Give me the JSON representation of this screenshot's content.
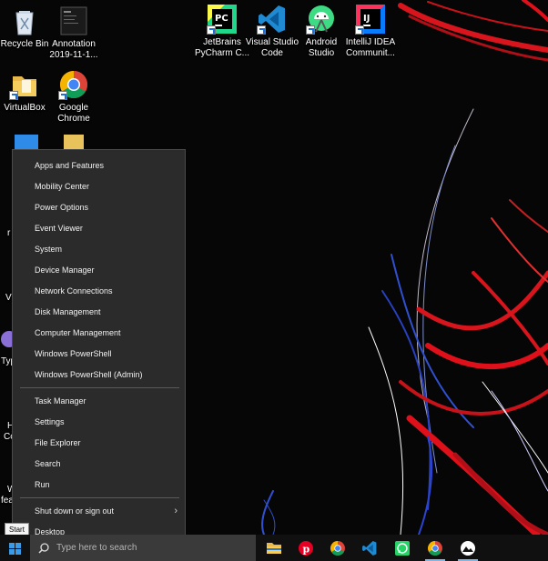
{
  "desktop_icons": [
    {
      "label": "Recycle Bin",
      "icon": "recycle-bin-icon"
    },
    {
      "label": "Annotation 2019-11-1...",
      "icon": "file-thumbnail-icon"
    },
    {
      "label": "VirtualBox",
      "icon": "folder-icon"
    },
    {
      "label": "Google Chrome",
      "icon": "chrome-icon"
    },
    {
      "label": "JetBrains PyCharm C...",
      "icon": "pycharm-icon"
    },
    {
      "label": "Visual Studio Code",
      "icon": "vscode-icon"
    },
    {
      "label": "Android Studio",
      "icon": "android-studio-icon"
    },
    {
      "label": "IntelliJ IDEA Communit...",
      "icon": "intellij-icon"
    }
  ],
  "partial_labels": [
    "r",
    "Vi",
    "Typ",
    "H",
    "Co",
    "W",
    "fea"
  ],
  "menu": {
    "group1": [
      "Apps and Features",
      "Mobility Center",
      "Power Options",
      "Event Viewer",
      "System",
      "Device Manager",
      "Network Connections",
      "Disk Management",
      "Computer Management",
      "Windows PowerShell",
      "Windows PowerShell (Admin)"
    ],
    "group2": [
      "Task Manager",
      "Settings",
      "File Explorer",
      "Search",
      "Run"
    ],
    "shutdown": "Shut down or sign out",
    "desktop": "Desktop"
  },
  "tooltip": "Start",
  "taskbar": {
    "search_placeholder": "Type here to search",
    "apps": [
      "file-explorer-icon",
      "pinterest-icon",
      "chrome-icon",
      "vscode-icon",
      "whatsapp-icon",
      "chrome-icon",
      "photos-icon"
    ]
  },
  "colors": {
    "menu_bg": "#2b2b2b",
    "taskbar_bg": "#101010",
    "search_bg": "#3a3a3a",
    "accent": "#e0101a"
  }
}
